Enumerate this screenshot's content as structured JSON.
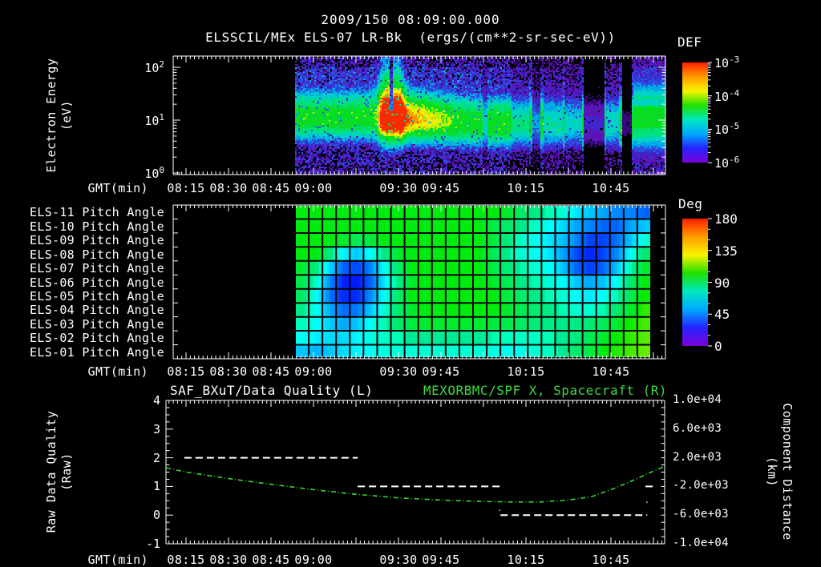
{
  "page": {
    "bg": "#000000",
    "fg": "#ffffff",
    "accent_green": "#3fd93f",
    "curve_green": "#35d435",
    "colormap_stops": [
      "#ff1e00",
      "#ff9c00",
      "#f8f400",
      "#20e000",
      "#00e8c0",
      "#00a8ff",
      "#2424ff",
      "#7c00d8"
    ]
  },
  "header": {
    "title": "2009/150 08:09:00.000",
    "subtitle": "ELSSCIL/MEx ELS-07 LR-Bk  (ergs/(cm**2-sr-sec-eV))"
  },
  "gmt_label": "GMT(min)",
  "time_ticks": [
    {
      "text": "08:15",
      "min": 15
    },
    {
      "text": "08:30",
      "min": 30
    },
    {
      "text": "08:45",
      "min": 45
    },
    {
      "text": "09:00",
      "min": 60
    },
    {
      "text": "09:30",
      "min": 90
    },
    {
      "text": "09:45",
      "min": 105
    },
    {
      "text": "10:15",
      "min": 135
    },
    {
      "text": "10:45",
      "min": 165
    }
  ],
  "spectrogram": {
    "ylabel1": "Electron Energy",
    "ylabel2": "(eV)",
    "yticks": [
      {
        "b": "10",
        "e": "2"
      },
      {
        "b": "10",
        "e": "1"
      },
      {
        "b": "10",
        "e": "0"
      }
    ],
    "colorbar": {
      "title": "DEF",
      "ticks": [
        {
          "b": "10",
          "e": "-3"
        },
        {
          "b": "10",
          "e": "-4"
        },
        {
          "b": "10",
          "e": "-5"
        },
        {
          "b": "10",
          "e": "-6"
        }
      ]
    }
  },
  "pitch": {
    "row_labels": [
      "ELS-11 Pitch Angle",
      "ELS-10 Pitch Angle",
      "ELS-09 Pitch Angle",
      "ELS-08 Pitch Angle",
      "ELS-07 Pitch Angle",
      "ELS-06 Pitch Angle",
      "ELS-05 Pitch Angle",
      "ELS-04 Pitch Angle",
      "ELS-03 Pitch Angle",
      "ELS-02 Pitch Angle",
      "ELS-01 Pitch Angle"
    ],
    "colorbar": {
      "title": "Deg",
      "ticks": [
        "180",
        "135",
        "90",
        "45",
        "0"
      ]
    }
  },
  "bottom": {
    "title_left": "SAF_BXuT/Data Quality (L)",
    "title_right": "MEXORBMC/SPF X, Spacecraft (R)",
    "ylabel_left1": "Raw Data Quality",
    "ylabel_left2": "(Raw)",
    "ylabel_right1": "Component Distance",
    "ylabel_right2": "(km)",
    "yticks_left": [
      "4",
      "3",
      "2",
      "1",
      "0",
      "-1"
    ],
    "yticks_right": [
      "1.0e+04",
      "6.0e+03",
      "2.0e+03",
      "-2.0e+03",
      "-6.0e+03",
      "-1.0e+04"
    ]
  },
  "chart_data": [
    {
      "type": "heatmap",
      "title": "ELSSCIL/MEx ELS-07 LR-Bk electron energy spectrogram",
      "xlabel": "GMT(min)",
      "ylabel": "Electron Energy (eV)",
      "x_range": [
        "08:09",
        "11:04"
      ],
      "data_start_min": 53.5,
      "y_scale": "log",
      "ylim_ev": [
        1,
        162
      ],
      "colorbar": {
        "title": "DEF",
        "units": "ergs/(cm**2-sr-sec-eV)",
        "ticks": [
          "1e-3",
          "1e-4",
          "1e-5",
          "1e-6"
        ]
      },
      "band": {
        "logE_center": 1.05,
        "sigma_up": 0.33,
        "sigma_down": 0.26,
        "amp": 0.55
      },
      "flare": {
        "spike_minutes": [
          85.2,
          89.2
        ],
        "notch_minute": 87.4,
        "amp": 0.8,
        "sigma_min": 1.7,
        "peak_logE": 1.95
      },
      "post_flare_decay": {
        "amp_at_peak": 1.0,
        "amp_min": 0.57,
        "rate_per_min": 0.02,
        "center_drift_per_min": 0.004,
        "center_min": 0.93
      },
      "dropouts": [
        {
          "t0": 119.4,
          "t1": 120.9,
          "f": 0.5
        },
        {
          "t0": 129.6,
          "t1": 136.1,
          "f": 0.62
        },
        {
          "t0": 137.0,
          "t1": 139.8,
          "f": 0.3
        },
        {
          "t0": 140.7,
          "t1": 147.5,
          "f": 0.55
        },
        {
          "t0": 148.3,
          "t1": 154.5,
          "f": 0.45
        },
        {
          "t0": 155.1,
          "t1": 162.5,
          "f": 0.12
        },
        {
          "t0": 163.3,
          "t1": 167.8,
          "f": 0.5
        },
        {
          "t0": 168.7,
          "t1": 171.8,
          "f": 0.05
        }
      ],
      "steady_band": {
        "t0": 172.9,
        "logE_center": 1.05,
        "sigma_up": 0.4,
        "sigma_down": 0.34,
        "amp": 0.52,
        "dark_line_logE": [
          1.28,
          1.4
        ]
      }
    },
    {
      "type": "heatmap",
      "title": "ELS-01..ELS-11 pitch angles (deg)",
      "xlabel": "GMT(min)",
      "x_range": [
        "08:53",
        "10:59"
      ],
      "rows_top_to_bottom": [
        "ELS-11",
        "ELS-10",
        "ELS-09",
        "ELS-08",
        "ELS-07",
        "ELS-06",
        "ELS-05",
        "ELS-04",
        "ELS-03",
        "ELS-02",
        "ELS-01"
      ],
      "colorbar": {
        "title": "Deg",
        "ticks": [
          180,
          135,
          90,
          45,
          0
        ]
      },
      "values_deg": [
        [
          100,
          100,
          100,
          100,
          100,
          100,
          100,
          100,
          100,
          100,
          100,
          100,
          100,
          100,
          100,
          95,
          85,
          80,
          75,
          70,
          60,
          55,
          50,
          45,
          45,
          40
        ],
        [
          100,
          100,
          100,
          100,
          100,
          100,
          100,
          100,
          100,
          100,
          100,
          100,
          100,
          100,
          90,
          85,
          80,
          72,
          65,
          58,
          50,
          45,
          40,
          40,
          50,
          55
        ],
        [
          100,
          100,
          100,
          95,
          88,
          92,
          100,
          100,
          100,
          100,
          100,
          100,
          100,
          100,
          92,
          82,
          72,
          66,
          60,
          54,
          45,
          35,
          35,
          42,
          55,
          70
        ],
        [
          100,
          100,
          82,
          62,
          55,
          65,
          80,
          95,
          100,
          100,
          100,
          100,
          100,
          100,
          88,
          78,
          70,
          66,
          60,
          50,
          36,
          30,
          35,
          46,
          65,
          85
        ],
        [
          95,
          82,
          57,
          40,
          35,
          45,
          65,
          85,
          100,
          100,
          100,
          100,
          100,
          100,
          90,
          82,
          76,
          70,
          65,
          55,
          40,
          34,
          40,
          55,
          75,
          95
        ],
        [
          90,
          72,
          46,
          30,
          28,
          40,
          60,
          80,
          95,
          100,
          100,
          100,
          100,
          100,
          95,
          88,
          80,
          75,
          70,
          64,
          55,
          50,
          55,
          65,
          85,
          100
        ],
        [
          86,
          66,
          43,
          31,
          31,
          46,
          65,
          85,
          100,
          100,
          100,
          100,
          100,
          100,
          100,
          92,
          85,
          80,
          75,
          70,
          64,
          60,
          65,
          75,
          90,
          104
        ],
        [
          80,
          66,
          51,
          41,
          43,
          55,
          70,
          85,
          95,
          100,
          100,
          100,
          100,
          100,
          100,
          95,
          88,
          84,
          80,
          75,
          70,
          70,
          75,
          85,
          95,
          110
        ],
        [
          74,
          65,
          56,
          50,
          55,
          65,
          75,
          85,
          92,
          95,
          95,
          95,
          95,
          95,
          92,
          90,
          86,
          82,
          80,
          80,
          80,
          83,
          88,
          95,
          105,
          114
        ],
        [
          66,
          61,
          58,
          58,
          62,
          68,
          72,
          75,
          78,
          78,
          78,
          78,
          78,
          78,
          76,
          73,
          72,
          72,
          75,
          78,
          82,
          88,
          95,
          104,
          111,
          117
        ],
        [
          55,
          52,
          55,
          58,
          62,
          65,
          68,
          70,
          70,
          70,
          70,
          70,
          70,
          70,
          68,
          66,
          67,
          70,
          73,
          78,
          85,
          92,
          100,
          108,
          114,
          119
        ]
      ]
    },
    {
      "type": "line",
      "xlabel": "GMT(min)",
      "x_range": [
        "08:08",
        "11:04"
      ],
      "ylim_left": [
        -1,
        4
      ],
      "ylim_right": [
        -10000,
        10000
      ],
      "series": [
        {
          "name": "SAF_BXuT/Data Quality (L)",
          "axis": "left",
          "color": "#ffffff",
          "style": "dashed",
          "segments": [
            {
              "value": 2,
              "t0": 14.4,
              "t1": 75.6
            },
            {
              "value": 1,
              "t0": 75.6,
              "t1": 125.7
            },
            {
              "value": 0.17,
              "t0": 125.55,
              "t1": 125.85
            },
            {
              "value": 0,
              "t0": 126.0,
              "t1": 177.8
            },
            {
              "value": 0.45,
              "t0": 177.55,
              "t1": 177.85
            },
            {
              "value": 1,
              "t0": 177.2,
              "t1": 180.0
            }
          ]
        },
        {
          "name": "MEXORBMC/SPF X, Spacecraft (R)",
          "axis": "right",
          "color": "#35d435",
          "style": "dash-dot",
          "points_min_km": [
            [
              8,
              600
            ],
            [
              15,
              0
            ],
            [
              30,
              -900
            ],
            [
              45,
              -1700
            ],
            [
              60,
              -2450
            ],
            [
              75,
              -3100
            ],
            [
              90,
              -3600
            ],
            [
              105,
              -3900
            ],
            [
              120,
              -4100
            ],
            [
              130,
              -4170
            ],
            [
              140,
              -4170
            ],
            [
              150,
              -3900
            ],
            [
              158,
              -3450
            ],
            [
              165,
              -2450
            ],
            [
              172,
              -1300
            ],
            [
              178,
              -200
            ],
            [
              184,
              800
            ]
          ]
        }
      ]
    }
  ]
}
